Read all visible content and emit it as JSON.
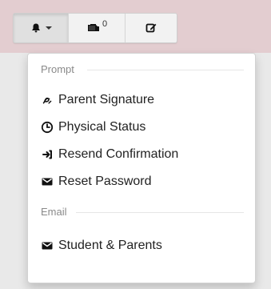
{
  "toolbar": {
    "notifications": {
      "icon": "bell-icon",
      "has_dropdown": true
    },
    "messages": {
      "icon": "message-icon",
      "count": "0"
    },
    "compose": {
      "icon": "edit-icon"
    }
  },
  "menu": {
    "sections": [
      {
        "header": "Prompt",
        "items": [
          {
            "label": "Parent Signature",
            "icon": "signature-icon"
          },
          {
            "label": "Physical Status",
            "icon": "clock-icon"
          },
          {
            "label": "Resend Confirmation",
            "icon": "resend-icon"
          },
          {
            "label": "Reset Password",
            "icon": "envelope-icon"
          }
        ]
      },
      {
        "header": "Email",
        "items": [
          {
            "label": "Student & Parents",
            "icon": "envelope-icon"
          }
        ]
      }
    ]
  }
}
